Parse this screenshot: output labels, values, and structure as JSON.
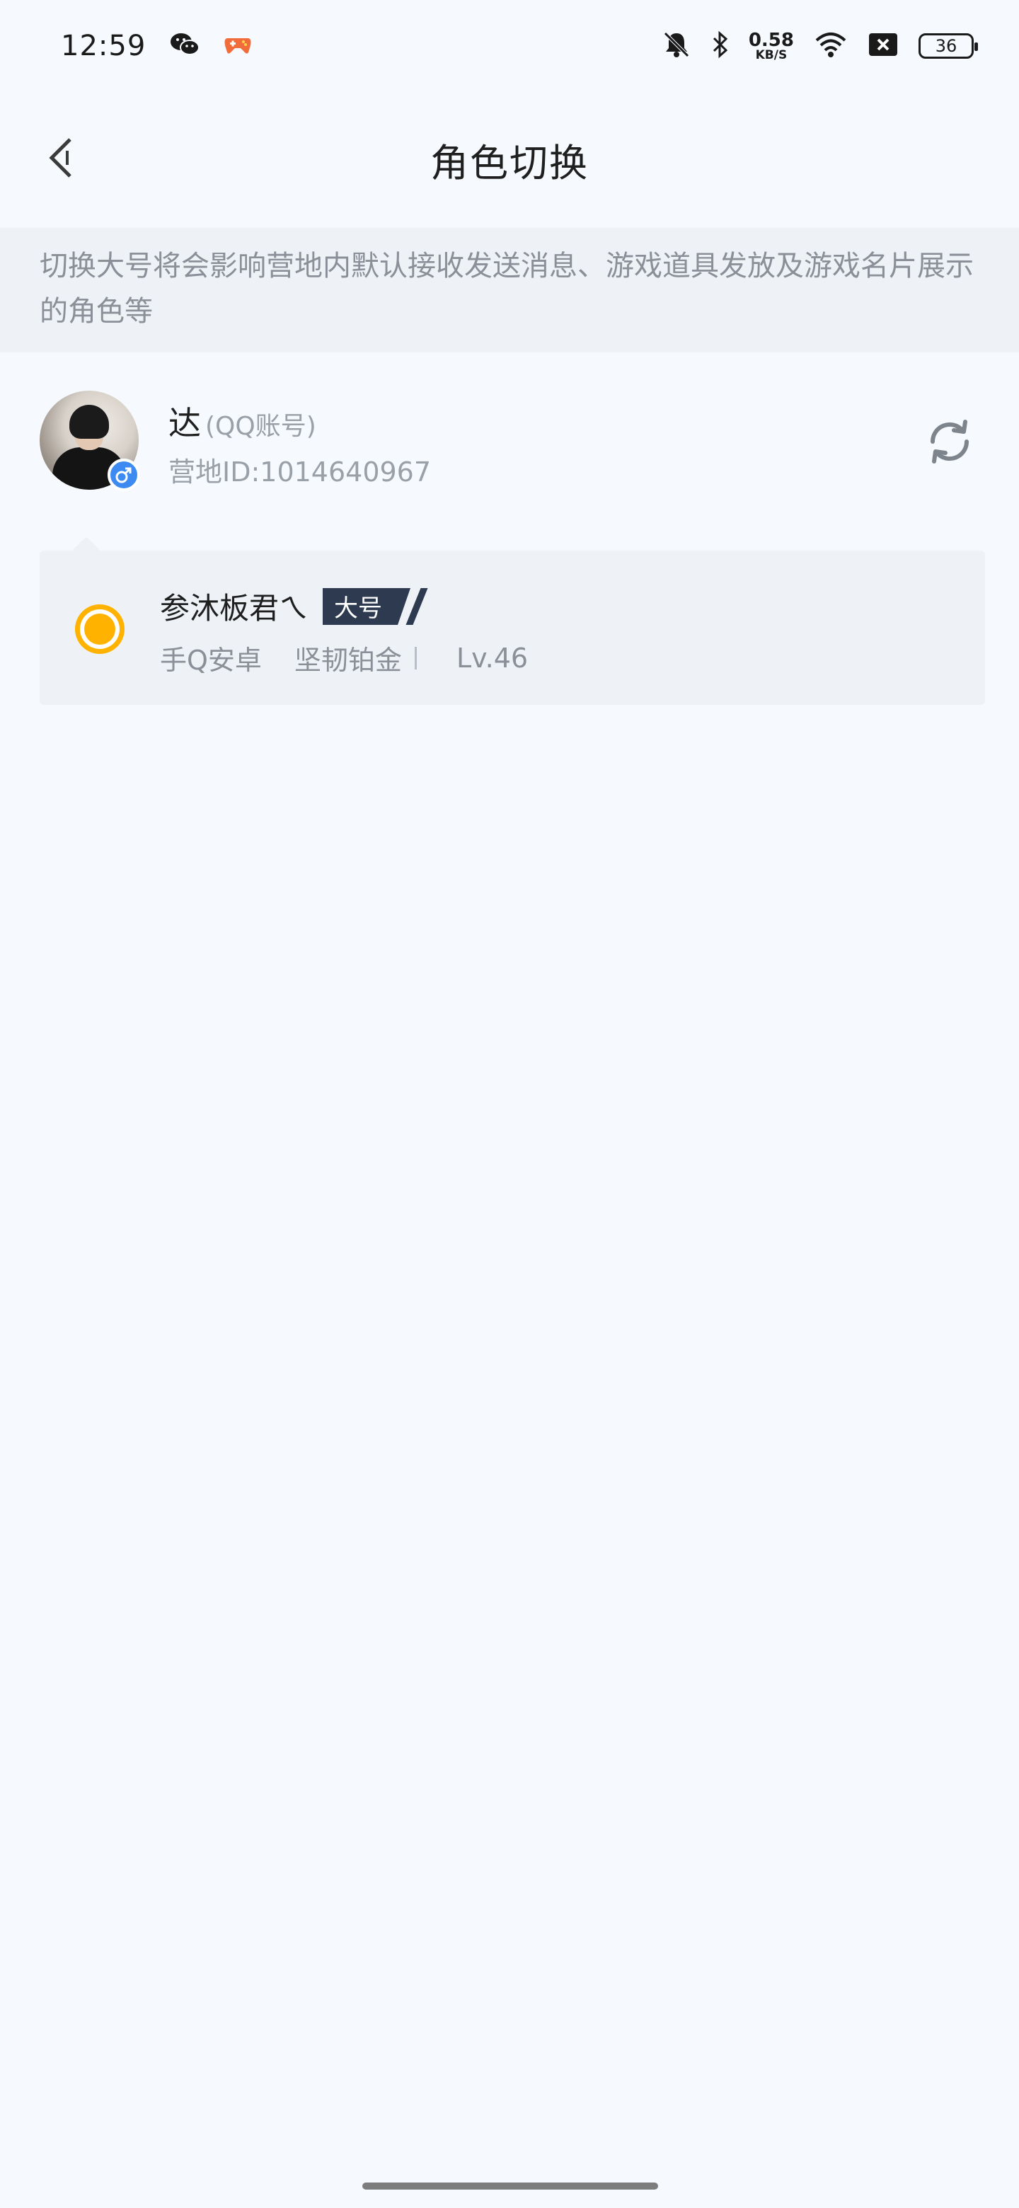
{
  "status_bar": {
    "time": "12:59",
    "net_speed_value": "0.58",
    "net_speed_unit": "KB/S",
    "battery": "36",
    "icons": [
      "wechat-icon",
      "game-controller-icon",
      "mute-icon",
      "bluetooth-icon",
      "wifi-icon",
      "sim-off-icon",
      "battery-icon"
    ]
  },
  "header": {
    "title": "角色切换",
    "back_icon": "chevron-left-icon"
  },
  "notice": {
    "text": "切换大号将会影响营地内默认接收发送消息、游戏道具发放及游戏名片展示的角色等"
  },
  "account": {
    "name": "达",
    "type": "(QQ账号)",
    "id_text": "营地ID:1014640967",
    "gender_icon": "male-icon",
    "refresh_icon": "refresh-icon"
  },
  "role": {
    "name": "参沐板君ㄟ",
    "badge": "大号",
    "platform": "手Q安卓",
    "rank": "坚韧铂金",
    "level": "Lv.46",
    "selected": true
  },
  "colors": {
    "background": "#f6f9fd",
    "accent_radio": "#ffb300",
    "badge_bg": "#2e3a4f",
    "gender_badge": "#3d8bf2"
  }
}
